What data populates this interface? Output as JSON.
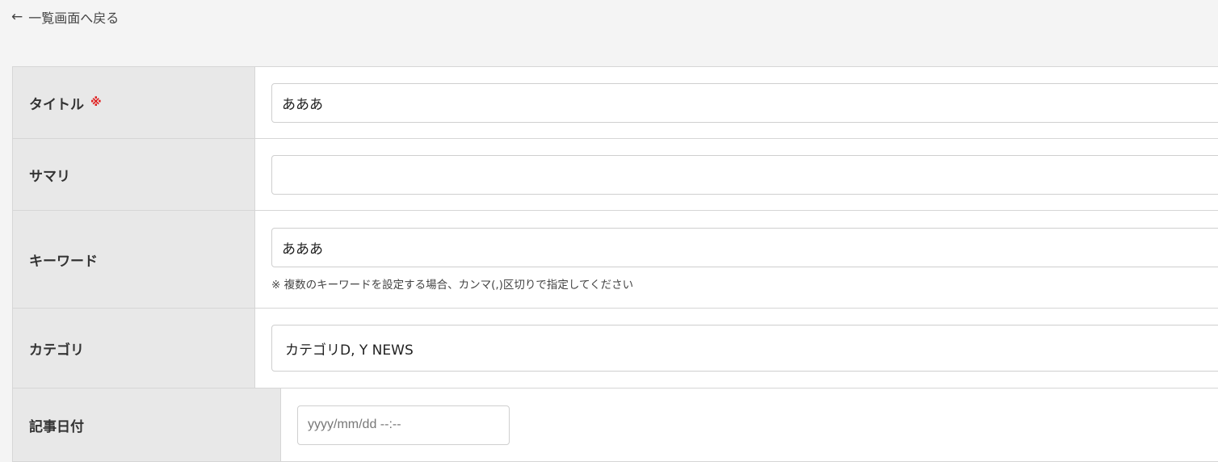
{
  "back_link": {
    "arrow": "←",
    "label": "一覧画面へ戻る"
  },
  "form": {
    "title": {
      "label": "タイトル",
      "required_mark": "※",
      "value": "あああ"
    },
    "summary": {
      "label": "サマリ",
      "value": ""
    },
    "keywords": {
      "label": "キーワード",
      "value": "あああ",
      "hint": "※ 複数のキーワードを設定する場合、カンマ(,)区切りで指定してください"
    },
    "category": {
      "label": "カテゴリ",
      "value": "カテゴリD, Y NEWS"
    },
    "article_date": {
      "label": "記事日付",
      "placeholder": "yyyy/mm/dd --:--"
    }
  },
  "colors": {
    "required": "#e02020",
    "label_bg": "#e8e8e8",
    "page_bg": "#f4f4f4"
  }
}
